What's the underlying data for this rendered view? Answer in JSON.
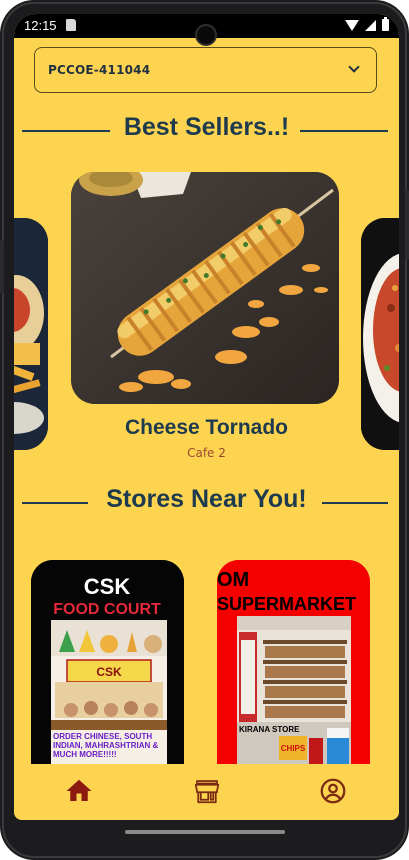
{
  "status_bar": {
    "time": "12:15"
  },
  "location": {
    "selected": "PCCOE-411044"
  },
  "sections": {
    "best_sellers": "Best Sellers..!",
    "stores_near_you": "Stores Near You!"
  },
  "best_seller": {
    "name": "Cheese Tornado",
    "store": "Cafe 2"
  },
  "stores": [
    {
      "title_line1": "CSK",
      "title_line2": "FOOD COURT",
      "sign": "CSK",
      "tagline": "ORDER CHINESE, SOUTH INDIAN, MAHRASHTRIAN & MUCH MORE!!!!!"
    },
    {
      "title_line1": "OM",
      "title_line2": "SUPERMARKET",
      "sign": "KIRANA STORE",
      "tagline": "CHIPS"
    }
  ],
  "nav": {
    "active_color": "#8b1a10",
    "inactive_color": "#7a2a12",
    "items": [
      "home-icon",
      "store-icon",
      "account-icon"
    ]
  },
  "colors": {
    "background": "#FDD44F",
    "heading": "#1e3a4e",
    "store_label": "#9b4a2e"
  }
}
